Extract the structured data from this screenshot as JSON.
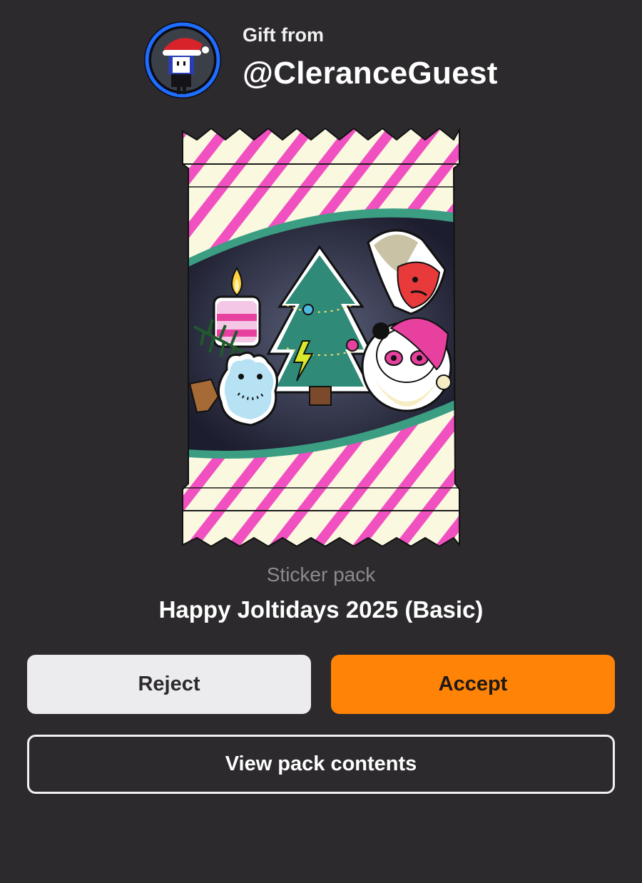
{
  "gift": {
    "label": "Gift from",
    "sender": "@CleranceGuest"
  },
  "pack": {
    "type_label": "Sticker pack",
    "name": "Happy Joltidays 2025 (Basic)"
  },
  "actions": {
    "reject_label": "Reject",
    "accept_label": "Accept",
    "view_label": "View pack contents"
  },
  "colors": {
    "background": "#2c2a2d",
    "accept": "#ff8306",
    "reject": "#ecebee",
    "stripe": "#f050c0",
    "wrapper": "#fbf8e0",
    "band": "#3b9e83"
  }
}
